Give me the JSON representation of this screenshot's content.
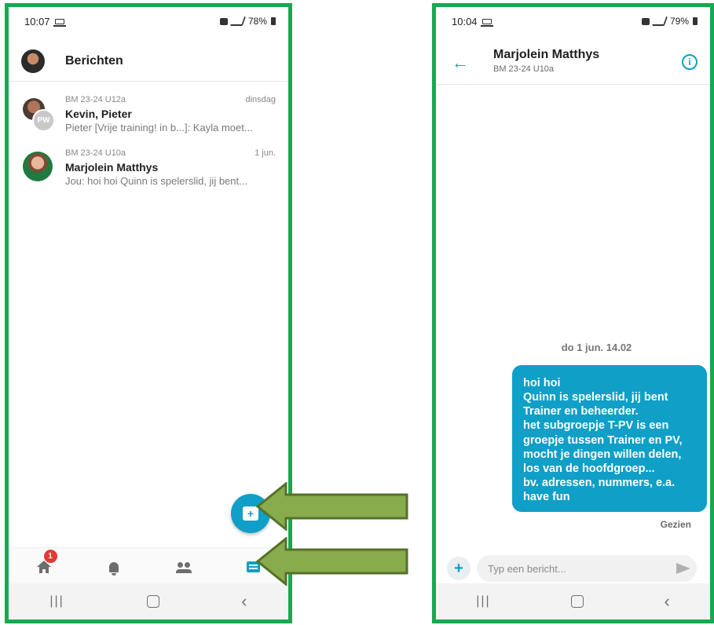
{
  "left_screen": {
    "status": {
      "time": "10:07",
      "battery": "78%"
    },
    "header": {
      "title": "Berichten"
    },
    "conversations": [
      {
        "group": "BM 23-24 U12a",
        "date": "dinsdag",
        "names": "Kevin, Pieter",
        "preview": "Pieter [Vrije training! in b...]: Kayla moet...",
        "avatar_initials": "PW"
      },
      {
        "group": "BM 23-24 U10a",
        "date": "1 jun.",
        "names": "Marjolein Matthys",
        "preview": "Jou: hoi hoi Quinn is spelerslid, jij bent..."
      }
    ],
    "bottom_nav": {
      "home_badge": "1"
    }
  },
  "right_screen": {
    "status": {
      "time": "10:04",
      "battery": "79%"
    },
    "header": {
      "name": "Marjolein Matthys",
      "group": "BM 23-24 U10a"
    },
    "date_label": "do 1 jun. 14.02",
    "message": "hoi hoi\nQuinn is spelerslid, jij bent Trainer en beheerder.\nhet subgroepje T-PV is een groepje tussen Trainer en PV, mocht je dingen willen delen, los van de hoofdgroep...\nbv. adressen, nummers, e.a.\nhave fun",
    "seen_label": "Gezien",
    "input_placeholder": "Typ een bericht..."
  },
  "colors": {
    "accent": "#0f9fc7",
    "frame": "#18a94e",
    "arrow": "#88ab4b",
    "badge": "#e53935"
  },
  "icons": [
    "home-icon",
    "bell-icon",
    "group-icon",
    "chat-icon",
    "back-arrow-icon",
    "info-icon",
    "send-icon",
    "plus-icon",
    "new-message-icon"
  ]
}
